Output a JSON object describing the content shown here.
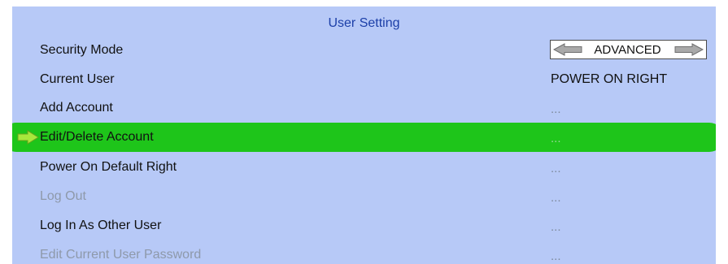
{
  "panel": {
    "title": "User Setting"
  },
  "rows": [
    {
      "label": "Security Mode",
      "value": "ADVANCED",
      "type": "selector",
      "state": "enabled"
    },
    {
      "label": "Current User",
      "value": "POWER ON RIGHT",
      "type": "text",
      "state": "enabled"
    },
    {
      "label": "Add Account",
      "value": "...",
      "type": "action",
      "state": "enabled"
    },
    {
      "label": "Edit/Delete Account",
      "value": "...",
      "type": "action",
      "state": "selected"
    },
    {
      "label": "Power On Default Right",
      "value": "...",
      "type": "action",
      "state": "enabled"
    },
    {
      "label": "Log Out",
      "value": "...",
      "type": "action",
      "state": "disabled"
    },
    {
      "label": "Log In As Other User",
      "value": "...",
      "type": "action",
      "state": "enabled"
    },
    {
      "label": "Edit Current User Password",
      "value": "...",
      "type": "action",
      "state": "disabled"
    }
  ],
  "icons": {
    "selection_indicator": "right-arrow-icon",
    "selector_prev": "left-arrow-icon",
    "selector_next": "right-arrow-icon"
  },
  "colors": {
    "panel_background": "#b7c9f7",
    "selection_highlight": "#1ec51a",
    "title_text": "#1c3fa8",
    "disabled_text": "#8e99aa",
    "selection_arrow": "#a8e83c"
  }
}
